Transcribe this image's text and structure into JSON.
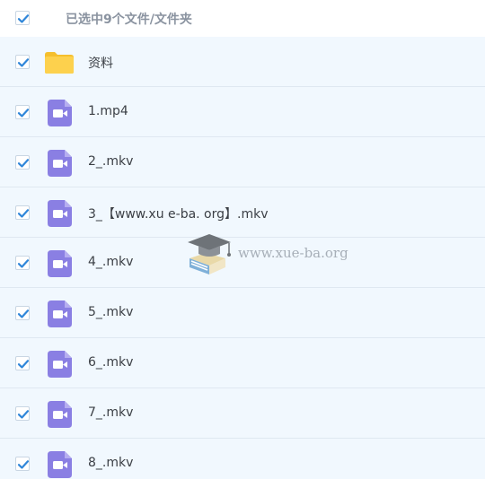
{
  "header": {
    "select_label": "已选中9个文件/文件夹",
    "checked": true
  },
  "files": [
    {
      "name": "资料",
      "type": "folder",
      "checked": true
    },
    {
      "name": "1.mp4",
      "type": "video",
      "checked": true
    },
    {
      "name": "2_.mkv",
      "type": "video",
      "checked": true
    },
    {
      "name": "3_【www.xu e-ba. org】.mkv",
      "type": "video",
      "checked": true
    },
    {
      "name": "4_.mkv",
      "type": "video",
      "checked": true
    },
    {
      "name": "5_.mkv",
      "type": "video",
      "checked": true
    },
    {
      "name": "6_.mkv",
      "type": "video",
      "checked": true
    },
    {
      "name": "7_.mkv",
      "type": "video",
      "checked": true
    },
    {
      "name": "8_.mkv",
      "type": "video",
      "checked": true
    }
  ],
  "watermark": {
    "text": "www.xue-ba.org"
  },
  "colors": {
    "checkmark": "#2f86d9",
    "folder": "#fdd14d",
    "video_icon": "#8a7fe3",
    "row_background": "#f1f8fe"
  },
  "icons": {
    "folder": "folder-icon",
    "video": "video-file-icon",
    "checkbox": "checkbox-checked-icon",
    "watermark": "graduation-cap-icon"
  }
}
